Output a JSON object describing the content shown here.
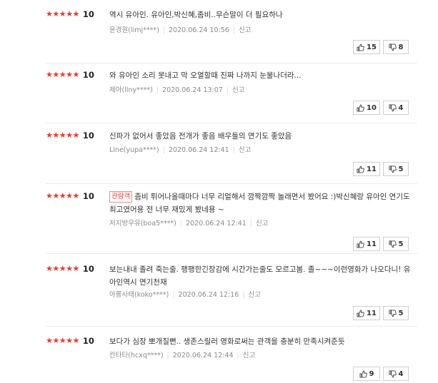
{
  "stars_glyph": "★★★★★",
  "report_label": "신고",
  "spoiler_badge": "관람객",
  "reviews": [
    {
      "score": "10",
      "text": "역시 유아인. 유아인,박신혜,좀비..무슨말이 더 필요하나",
      "author": "윤경원(limj****)",
      "date": "2020.06.24 10:56",
      "likes": "15",
      "dislikes": "8"
    },
    {
      "score": "10",
      "text": "와 유아인 소리 못내고 막 오열할때 진짜 나까지 눈물나더라...",
      "author": "제아(llny****)",
      "date": "2020.06.24 13:07",
      "likes": "10",
      "dislikes": "4"
    },
    {
      "score": "10",
      "text": "신파가 없어서 좋았음 전개가 좋음 배우들의 연기도 좋았음",
      "author": "Line(yupa****)",
      "date": "2020.06.24 12:41",
      "likes": "11",
      "dislikes": "5"
    },
    {
      "score": "10",
      "text": "좀비 튀어나올때마다 너무 리얼해서 깜짝깜짝 놀래면서 봤어요 :)박신혜랑 유아인 연기도 최고였어용 전 너무 재밌게 봤네용 ~",
      "author": "저지방우유(boa5****)",
      "date": "2020.06.24 12:41",
      "likes": "11",
      "dislikes": "5"
    },
    {
      "score": "10",
      "text": "보는내내 졸려 죽는줄. 팽팽한긴장감에 시간가는줄도 모르고봄. 졸~~~이런영화가 나오다니! 유아인역시 연기천재",
      "author": "아롱사태(koko****)",
      "date": "2020.06.24 12:16",
      "likes": "11",
      "dislikes": "5"
    },
    {
      "score": "10",
      "text": "보다가 심장 뽀개질뻔.. 생존스릴러 영화로써는 관객을 충분히 만족시켜준듯",
      "author": "칸타타(hcxq****)",
      "date": "2020.06.24 12:44",
      "likes": "9",
      "dislikes": "4"
    }
  ]
}
